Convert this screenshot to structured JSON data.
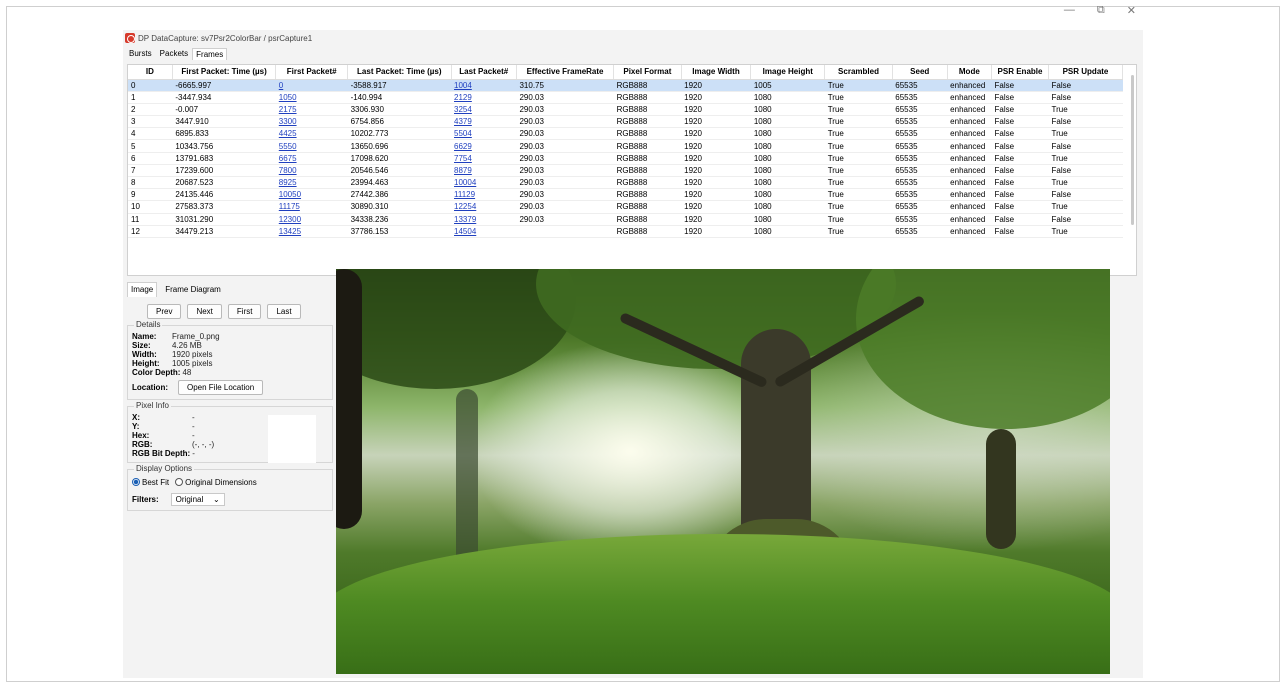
{
  "window": {
    "title": "DP DataCapture: sv7Psr2ColorBar / psrCapture1",
    "controls": [
      "—",
      "⧉",
      "✕"
    ]
  },
  "top_tabs": [
    "Bursts",
    "Packets",
    "Frames"
  ],
  "active_top_tab": "Frames",
  "table": {
    "columns": [
      "ID",
      "First Packet: Time (µs)",
      "First Packet#",
      "Last Packet: Time (µs)",
      "Last Packet#",
      "Effective FrameRate",
      "Pixel Format",
      "Image Width",
      "Image Height",
      "Scrambled",
      "Seed",
      "Mode",
      "PSR Enable",
      "PSR Update"
    ],
    "rows": [
      [
        "0",
        "-6665.997",
        "0",
        "-3588.917",
        "1004",
        "310.75",
        "RGB888",
        "1920",
        "1005",
        "True",
        "65535",
        "enhanced",
        "False",
        "False"
      ],
      [
        "1",
        "-3447.934",
        "1050",
        "-140.994",
        "2129",
        "290.03",
        "RGB888",
        "1920",
        "1080",
        "True",
        "65535",
        "enhanced",
        "False",
        "False"
      ],
      [
        "2",
        "-0.007",
        "2175",
        "3306.930",
        "3254",
        "290.03",
        "RGB888",
        "1920",
        "1080",
        "True",
        "65535",
        "enhanced",
        "False",
        "True"
      ],
      [
        "3",
        "3447.910",
        "3300",
        "6754.856",
        "4379",
        "290.03",
        "RGB888",
        "1920",
        "1080",
        "True",
        "65535",
        "enhanced",
        "False",
        "False"
      ],
      [
        "4",
        "6895.833",
        "4425",
        "10202.773",
        "5504",
        "290.03",
        "RGB888",
        "1920",
        "1080",
        "True",
        "65535",
        "enhanced",
        "False",
        "True"
      ],
      [
        "5",
        "10343.756",
        "5550",
        "13650.696",
        "6629",
        "290.03",
        "RGB888",
        "1920",
        "1080",
        "True",
        "65535",
        "enhanced",
        "False",
        "False"
      ],
      [
        "6",
        "13791.683",
        "6675",
        "17098.620",
        "7754",
        "290.03",
        "RGB888",
        "1920",
        "1080",
        "True",
        "65535",
        "enhanced",
        "False",
        "True"
      ],
      [
        "7",
        "17239.600",
        "7800",
        "20546.546",
        "8879",
        "290.03",
        "RGB888",
        "1920",
        "1080",
        "True",
        "65535",
        "enhanced",
        "False",
        "False"
      ],
      [
        "8",
        "20687.523",
        "8925",
        "23994.463",
        "10004",
        "290.03",
        "RGB888",
        "1920",
        "1080",
        "True",
        "65535",
        "enhanced",
        "False",
        "True"
      ],
      [
        "9",
        "24135.446",
        "10050",
        "27442.386",
        "11129",
        "290.03",
        "RGB888",
        "1920",
        "1080",
        "True",
        "65535",
        "enhanced",
        "False",
        "False"
      ],
      [
        "10",
        "27583.373",
        "11175",
        "30890.310",
        "12254",
        "290.03",
        "RGB888",
        "1920",
        "1080",
        "True",
        "65535",
        "enhanced",
        "False",
        "True"
      ],
      [
        "11",
        "31031.290",
        "12300",
        "34338.236",
        "13379",
        "290.03",
        "RGB888",
        "1920",
        "1080",
        "True",
        "65535",
        "enhanced",
        "False",
        "False"
      ],
      [
        "12",
        "34479.213",
        "13425",
        "37786.153",
        "14504",
        "",
        "RGB888",
        "1920",
        "1080",
        "True",
        "65535",
        "enhanced",
        "False",
        "True"
      ]
    ],
    "selected_row": 0
  },
  "lower_tabs": [
    "Image",
    "Frame Diagram"
  ],
  "active_lower_tab": "Image",
  "nav_buttons": {
    "prev": "Prev",
    "next": "Next",
    "first": "First",
    "last": "Last"
  },
  "details": {
    "title": "Details",
    "name_label": "Name:",
    "name": "Frame_0.png",
    "size_label": "Size:",
    "size": "4.26 MB",
    "width_label": "Width:",
    "width": "1920 pixels",
    "height_label": "Height:",
    "height": "1005 pixels",
    "depth_label": "Color Depth:",
    "depth": "48",
    "location_label": "Location:",
    "open_button": "Open File Location"
  },
  "pixel_info": {
    "title": "Pixel Info",
    "x_label": "X:",
    "x": "-",
    "y_label": "Y:",
    "y": "-",
    "hex_label": "Hex:",
    "hex": "-",
    "rgb_label": "RGB:",
    "rgb": "(-, -, -)",
    "bitdepth_label": "RGB Bit Depth:",
    "bitdepth": "-"
  },
  "display_options": {
    "title": "Display Options",
    "best_fit": "Best Fit",
    "original_dimensions": "Original Dimensions",
    "selected": "Best Fit",
    "filters_label": "Filters:",
    "filter_value": "Original"
  },
  "colors": {
    "selection": "#cce0f7",
    "link": "#1f3fbf",
    "logo": "#d63a2c"
  }
}
